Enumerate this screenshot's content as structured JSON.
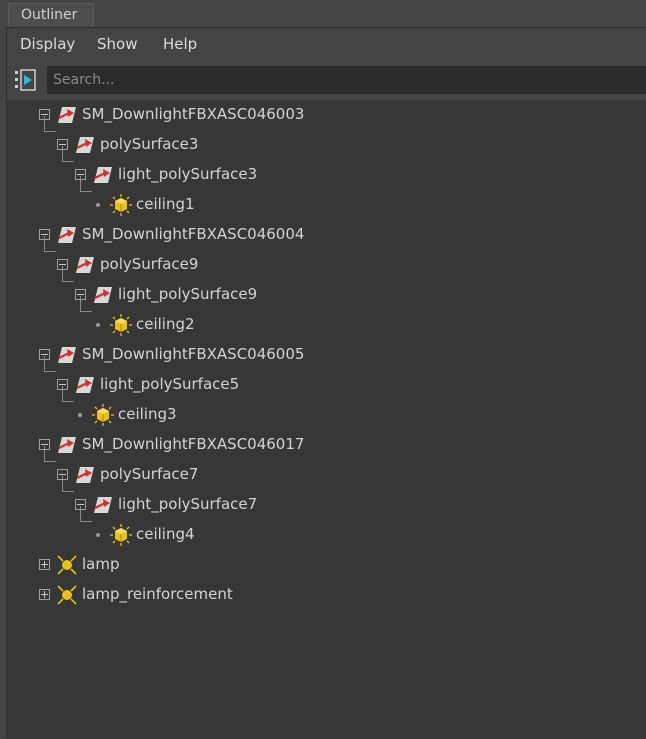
{
  "tab": {
    "title": "Outliner"
  },
  "menu": {
    "display": "Display",
    "show": "Show",
    "help": "Help"
  },
  "search": {
    "placeholder": "Search..."
  },
  "tree": {
    "rows": [
      {
        "label": "SM_DownlightFBXASC046003",
        "icon": "transform-icon",
        "expanded": true
      },
      {
        "label": "polySurface3",
        "icon": "transform-icon",
        "expanded": true
      },
      {
        "label": "light_polySurface3",
        "icon": "transform-icon",
        "expanded": true
      },
      {
        "label": "ceiling1",
        "icon": "area-light-icon"
      },
      {
        "label": "SM_DownlightFBXASC046004",
        "icon": "transform-icon",
        "expanded": true
      },
      {
        "label": "polySurface9",
        "icon": "transform-icon",
        "expanded": true
      },
      {
        "label": "light_polySurface9",
        "icon": "transform-icon",
        "expanded": true
      },
      {
        "label": "ceiling2",
        "icon": "area-light-icon"
      },
      {
        "label": "SM_DownlightFBXASC046005",
        "icon": "transform-icon",
        "expanded": true
      },
      {
        "label": "light_polySurface5",
        "icon": "transform-icon",
        "expanded": true
      },
      {
        "label": "ceiling3",
        "icon": "area-light-icon"
      },
      {
        "label": "SM_DownlightFBXASC046017",
        "icon": "transform-icon",
        "expanded": true
      },
      {
        "label": "polySurface7",
        "icon": "transform-icon",
        "expanded": true
      },
      {
        "label": "light_polySurface7",
        "icon": "transform-icon",
        "expanded": true
      },
      {
        "label": "ceiling4",
        "icon": "area-light-icon"
      },
      {
        "label": "lamp",
        "icon": "point-light-icon",
        "expanded": false
      },
      {
        "label": "lamp_reinforcement",
        "icon": "point-light-icon",
        "expanded": false
      }
    ]
  },
  "colors": {
    "background": "#444444",
    "tree_background": "#373737",
    "search_background": "#2b2b2b",
    "light_yellow": "#e8c020",
    "transform_red": "#d03030"
  }
}
